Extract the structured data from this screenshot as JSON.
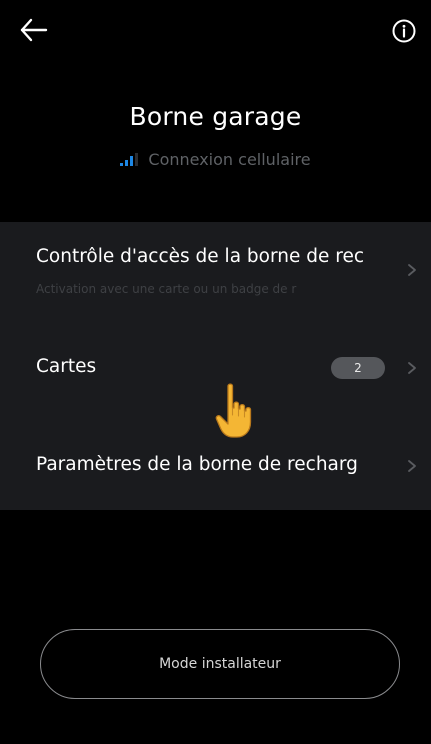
{
  "header": {
    "back_icon": "arrow-left-icon",
    "info_icon": "info-circle-icon"
  },
  "device": {
    "name": "Borne garage",
    "connection_icon": "cellular-signal-icon",
    "connection_label": "Connexion cellulaire",
    "connection_color": "#1e88e5"
  },
  "menu": {
    "items": [
      {
        "title": "Contrôle d'accès de la borne de rec",
        "subtitle": "Activation avec une carte ou un badge de r",
        "icon": "chevron-right-icon"
      },
      {
        "title": "Cartes",
        "badge": "2",
        "icon": "chevron-right-icon"
      },
      {
        "title": "Paramètres de la borne de recharg",
        "icon": "chevron-right-icon"
      }
    ]
  },
  "footer": {
    "mode_button_label": "Mode installateur"
  },
  "colors": {
    "background": "#000000",
    "card": "#1a1b1e",
    "muted_text": "#5f6266",
    "badge": "#55575b"
  }
}
